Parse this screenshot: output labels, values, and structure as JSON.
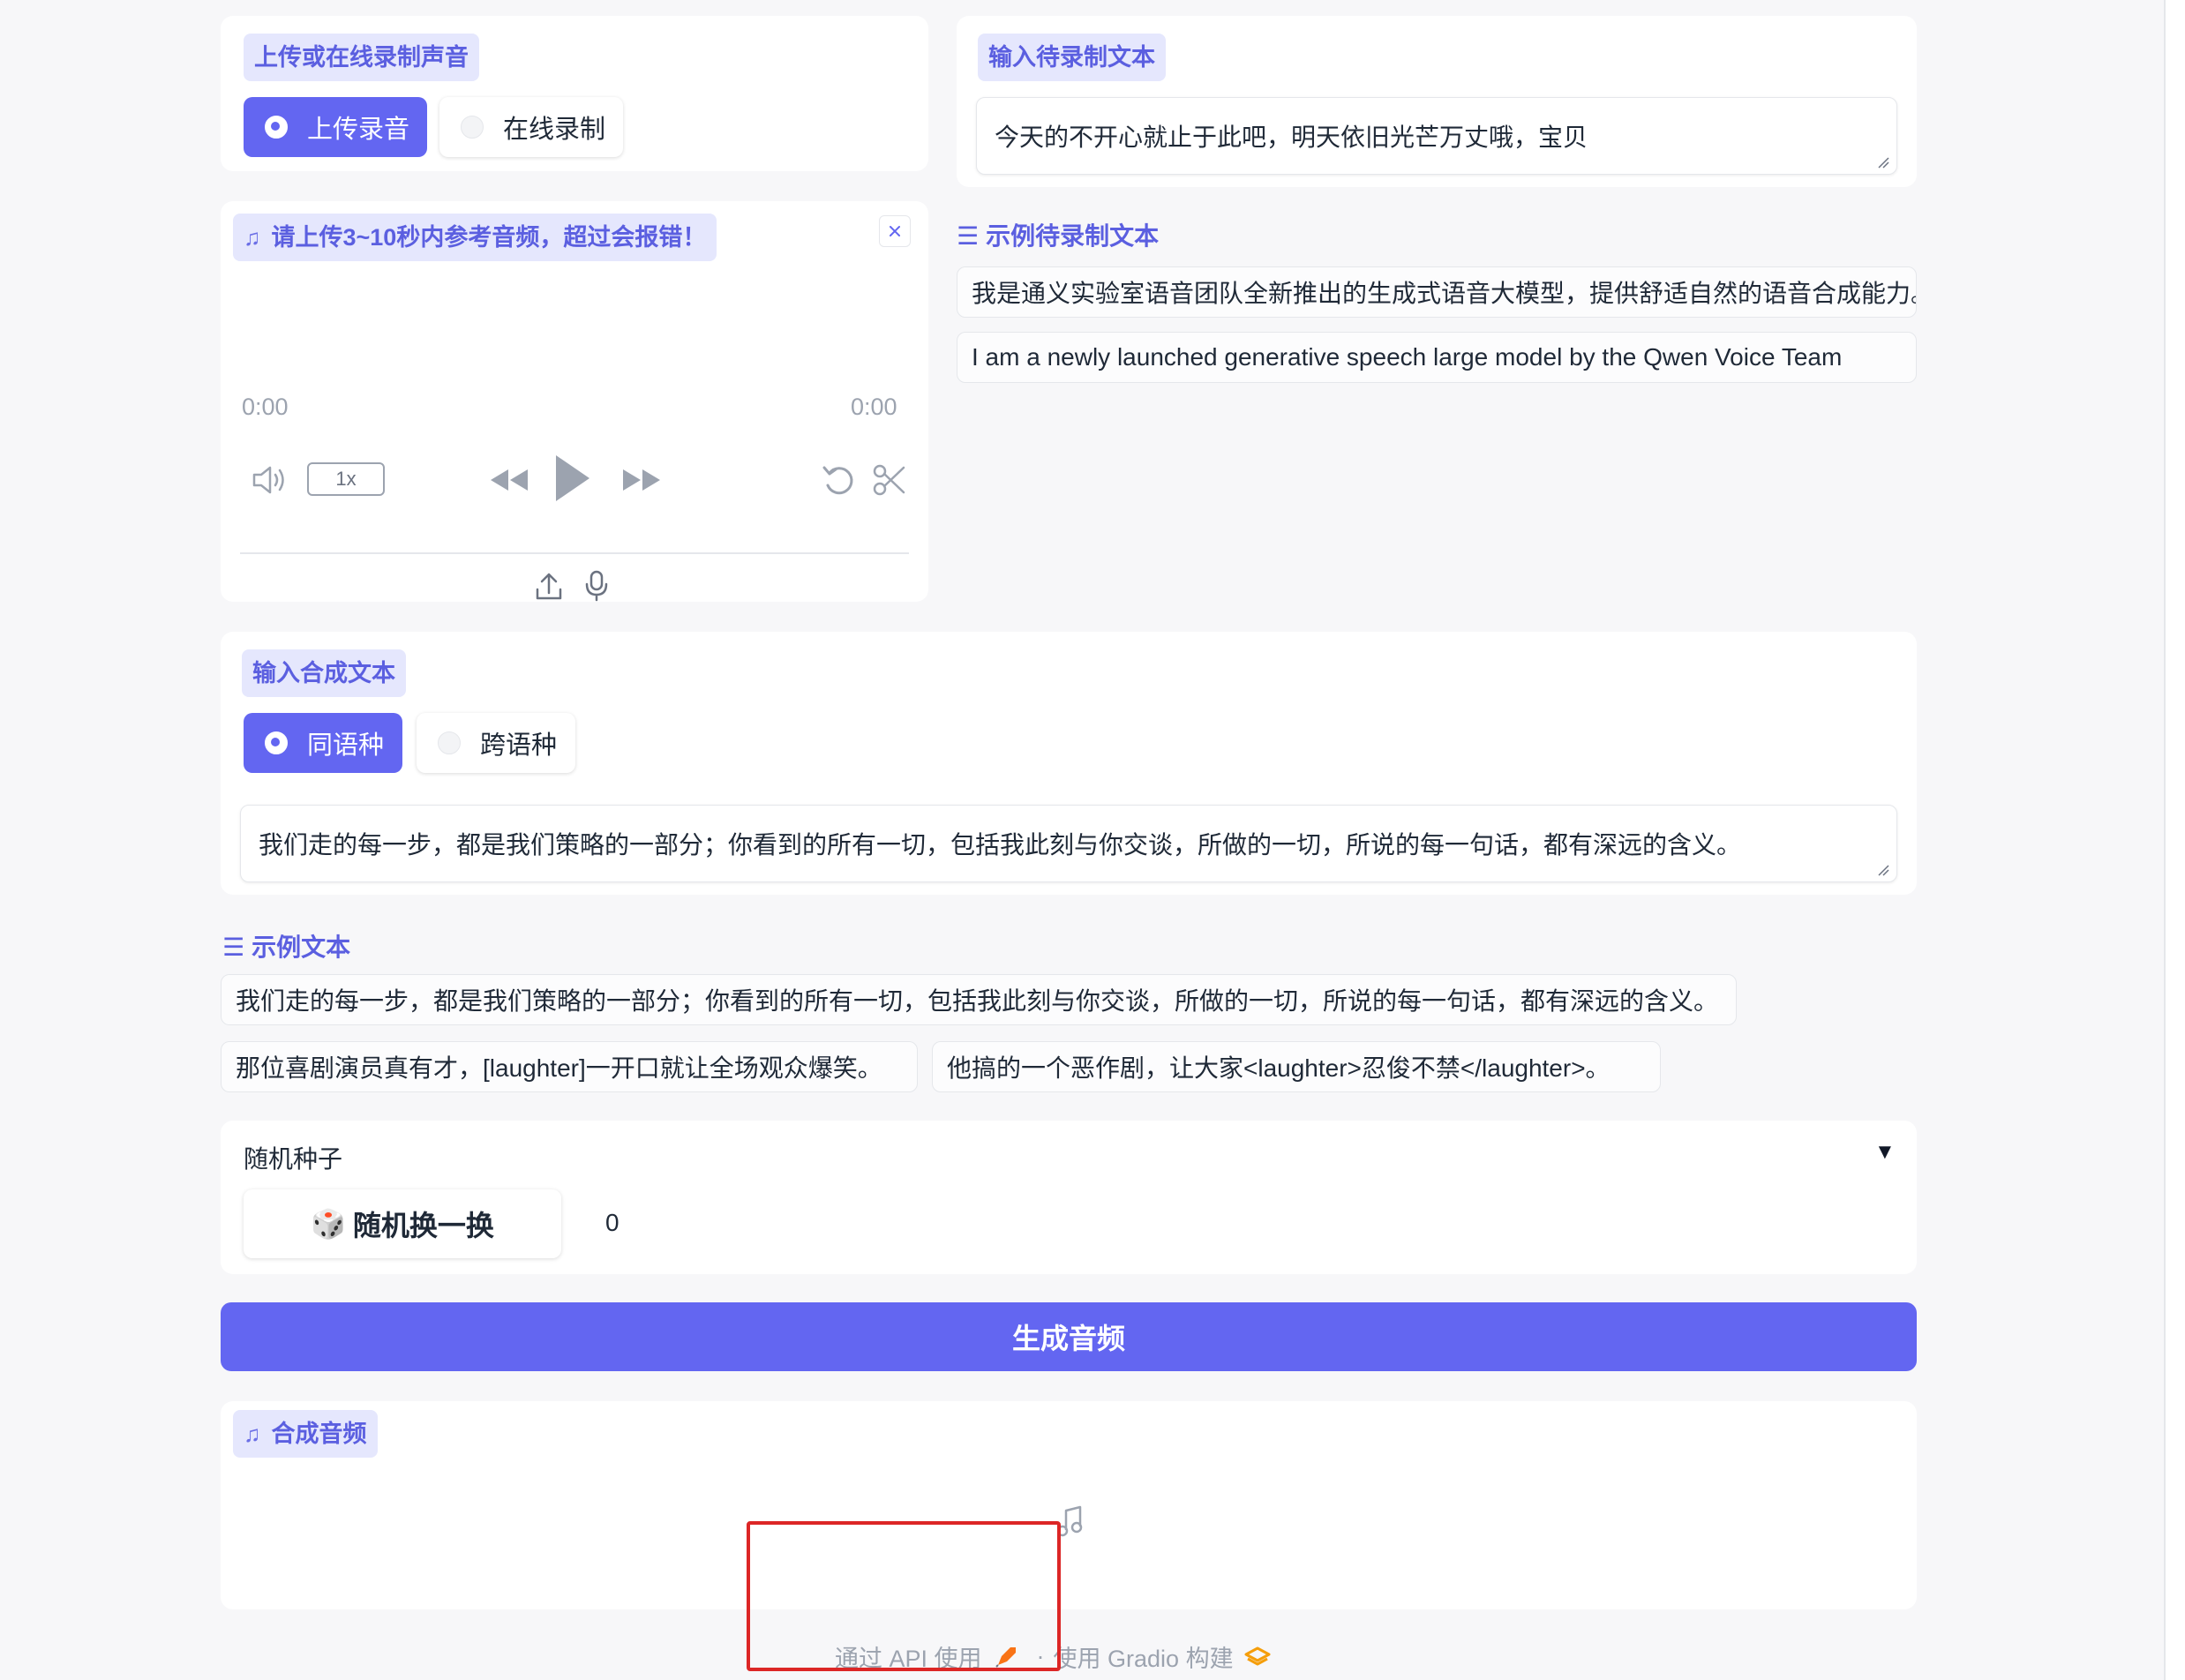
{
  "upload_panel": {
    "tag": "上传或在线录制声音",
    "options": [
      "上传录音",
      "在线录制"
    ],
    "selected_index": 0
  },
  "audio_input": {
    "label": "请上传3~10秒内参考音频，超过会报错！",
    "time_current": "0:00",
    "time_total": "0:00",
    "speed": "1x"
  },
  "prompt_text": {
    "tag": "输入待录制文本",
    "value": "今天的不开心就止于此吧，明天依旧光芒万丈哦，宝贝"
  },
  "prompt_examples": {
    "label": "示例待录制文本",
    "items": [
      "我是通义实验室语音团队全新推出的生成式语音大模型，提供舒适自然的语音合成能力。",
      "I am a newly launched generative speech large model by the Qwen Voice Team"
    ]
  },
  "tts_panel": {
    "tag": "输入合成文本",
    "options": [
      "同语种",
      "跨语种"
    ],
    "selected_index": 0,
    "value": "我们走的每一步，都是我们策略的一部分；你看到的所有一切，包括我此刻与你交谈，所做的一切，所说的每一句话，都有深远的含义。"
  },
  "examples": {
    "label": "示例文本",
    "items": [
      "我们走的每一步，都是我们策略的一部分；你看到的所有一切，包括我此刻与你交谈，所做的一切，所说的每一句话，都有深远的含义。",
      "那位喜剧演员真有才，[laughter]一开口就让全场观众爆笑。",
      "他搞的一个恶作剧，让大家<laughter>忍俊不禁</laughter>。"
    ]
  },
  "seed": {
    "label": "随机种子",
    "button": "随机换一换",
    "button_icon": "🎲",
    "value": "0",
    "collapse_glyph": "▼"
  },
  "generate_button": "生成音频",
  "output": {
    "tag": "合成音频"
  },
  "footer": {
    "api": "通过 API 使用",
    "sep": "·",
    "built": "使用 Gradio 构建"
  },
  "colors": {
    "accent": "#6366f1",
    "tag_bg": "#e5e7fd",
    "highlight_box": "#dc2626"
  }
}
